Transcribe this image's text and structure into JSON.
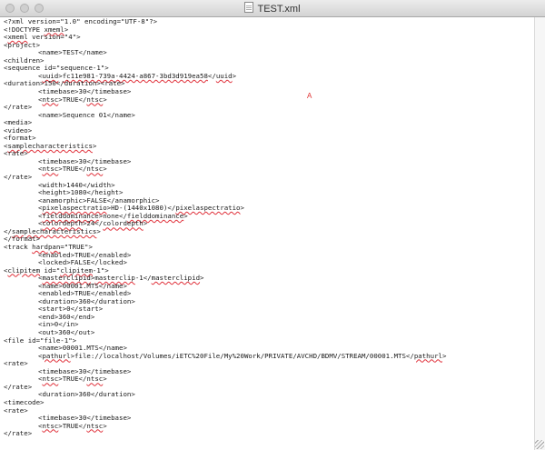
{
  "window": {
    "title": "TEST.xml",
    "cursor_mark": "A"
  },
  "lines": [
    {
      "indent": 0,
      "parts": [
        {
          "t": "<?xml version=\"1.0\" encoding=\"UTF-8\"?>"
        }
      ]
    },
    {
      "indent": 0,
      "parts": [
        {
          "t": "<!DOCTYPE "
        },
        {
          "t": "xmeml",
          "spell": true
        },
        {
          "t": ">"
        }
      ]
    },
    {
      "indent": 0,
      "parts": [
        {
          "t": "<"
        },
        {
          "t": "xmeml",
          "spell": true
        },
        {
          "t": " version=\"4\">"
        }
      ]
    },
    {
      "indent": 0,
      "parts": [
        {
          "t": "<project>"
        }
      ]
    },
    {
      "indent": 1,
      "parts": [
        {
          "t": "<name>TEST</name>"
        }
      ]
    },
    {
      "indent": 0,
      "parts": [
        {
          "t": "<children>"
        }
      ]
    },
    {
      "indent": 0,
      "parts": [
        {
          "t": "<sequence id=\"sequence-1\">"
        }
      ]
    },
    {
      "indent": 1,
      "parts": [
        {
          "t": "<"
        },
        {
          "t": "uuid",
          "spell": true
        },
        {
          "t": ">"
        },
        {
          "t": "fc11e981-739a-4424-a867-3bd3d919ea58",
          "spell": true
        },
        {
          "t": "</"
        },
        {
          "t": "uuid",
          "spell": true
        },
        {
          "t": ">"
        }
      ]
    },
    {
      "indent": 0,
      "parts": [
        {
          "t": "<duration>150</duration><rate>"
        }
      ]
    },
    {
      "indent": 1,
      "parts": [
        {
          "t": "<timebase>30</timebase>"
        }
      ]
    },
    {
      "indent": 1,
      "parts": [
        {
          "t": "<"
        },
        {
          "t": "ntsc",
          "spell": true
        },
        {
          "t": ">TRUE</"
        },
        {
          "t": "ntsc",
          "spell": true
        },
        {
          "t": ">"
        }
      ]
    },
    {
      "indent": 0,
      "parts": [
        {
          "t": "</rate>"
        }
      ]
    },
    {
      "indent": 1,
      "parts": [
        {
          "t": "<name>Sequence 01</name>"
        }
      ]
    },
    {
      "indent": 0,
      "parts": [
        {
          "t": "<media>"
        }
      ]
    },
    {
      "indent": 0,
      "parts": [
        {
          "t": "<video>"
        }
      ]
    },
    {
      "indent": 0,
      "parts": [
        {
          "t": "<format>"
        }
      ]
    },
    {
      "indent": 0,
      "parts": [
        {
          "t": "<"
        },
        {
          "t": "samplecharacteristics",
          "spell": true
        },
        {
          "t": ">"
        }
      ]
    },
    {
      "indent": 0,
      "parts": [
        {
          "t": "<rate>"
        }
      ]
    },
    {
      "indent": 1,
      "parts": [
        {
          "t": "<timebase>30</timebase>"
        }
      ]
    },
    {
      "indent": 1,
      "parts": [
        {
          "t": "<"
        },
        {
          "t": "ntsc",
          "spell": true
        },
        {
          "t": ">TRUE</"
        },
        {
          "t": "ntsc",
          "spell": true
        },
        {
          "t": ">"
        }
      ]
    },
    {
      "indent": 0,
      "parts": [
        {
          "t": "</rate>"
        }
      ]
    },
    {
      "indent": 1,
      "parts": [
        {
          "t": "<width>1440</width>"
        }
      ]
    },
    {
      "indent": 1,
      "parts": [
        {
          "t": "<height>1080</height>"
        }
      ]
    },
    {
      "indent": 1,
      "parts": [
        {
          "t": "<anamorphic>FALSE</anamorphic>"
        }
      ]
    },
    {
      "indent": 1,
      "parts": [
        {
          "t": "<"
        },
        {
          "t": "pixelaspectratio",
          "spell": true
        },
        {
          "t": ">HD-(1440x1080)</"
        },
        {
          "t": "pixelaspectratio",
          "spell": true
        },
        {
          "t": ">"
        }
      ]
    },
    {
      "indent": 1,
      "parts": [
        {
          "t": "<"
        },
        {
          "t": "fielddominance",
          "spell": true
        },
        {
          "t": ">none</"
        },
        {
          "t": "fielddominance",
          "spell": true
        },
        {
          "t": ">"
        }
      ]
    },
    {
      "indent": 1,
      "parts": [
        {
          "t": "<"
        },
        {
          "t": "colordepth",
          "spell": true
        },
        {
          "t": ">24</"
        },
        {
          "t": "colordepth",
          "spell": true
        },
        {
          "t": ">"
        }
      ]
    },
    {
      "indent": 0,
      "parts": [
        {
          "t": "</"
        },
        {
          "t": "samplecharacteristics",
          "spell": true
        },
        {
          "t": ">"
        }
      ]
    },
    {
      "indent": 0,
      "parts": [
        {
          "t": "</format>"
        }
      ]
    },
    {
      "indent": 0,
      "parts": [
        {
          "t": "<track "
        },
        {
          "t": "hardpan",
          "spell": true
        },
        {
          "t": "=\"TRUE\">"
        }
      ]
    },
    {
      "indent": 1,
      "parts": [
        {
          "t": "<enabled>TRUE</enabled>"
        }
      ]
    },
    {
      "indent": 1,
      "parts": [
        {
          "t": "<locked>FALSE</locked>"
        }
      ]
    },
    {
      "indent": 0,
      "parts": [
        {
          "t": "<"
        },
        {
          "t": "clipitem",
          "spell": true
        },
        {
          "t": " id=\""
        },
        {
          "t": "clipitem",
          "spell": true
        },
        {
          "t": "-1\">"
        }
      ]
    },
    {
      "indent": 1,
      "parts": [
        {
          "t": "<"
        },
        {
          "t": "masterclipid",
          "spell": true
        },
        {
          "t": ">"
        },
        {
          "t": "masterclip",
          "spell": true
        },
        {
          "t": "-1</"
        },
        {
          "t": "masterclipid",
          "spell": true
        },
        {
          "t": ">"
        }
      ]
    },
    {
      "indent": 1,
      "parts": [
        {
          "t": "<name>00001.MTS</name>"
        }
      ]
    },
    {
      "indent": 1,
      "parts": [
        {
          "t": "<enabled>TRUE</enabled>"
        }
      ]
    },
    {
      "indent": 1,
      "parts": [
        {
          "t": "<duration>360</duration>"
        }
      ]
    },
    {
      "indent": 1,
      "parts": [
        {
          "t": "<start>0</start>"
        }
      ]
    },
    {
      "indent": 1,
      "parts": [
        {
          "t": "<end>360</end>"
        }
      ]
    },
    {
      "indent": 1,
      "parts": [
        {
          "t": "<in>0</in>"
        }
      ]
    },
    {
      "indent": 1,
      "parts": [
        {
          "t": "<out>360</out>"
        }
      ]
    },
    {
      "indent": 0,
      "parts": [
        {
          "t": "<file id=\"file-1\">"
        }
      ]
    },
    {
      "indent": 1,
      "parts": [
        {
          "t": "<name>00001.MTS</name>"
        }
      ]
    },
    {
      "indent": 1,
      "parts": [
        {
          "t": "<"
        },
        {
          "t": "pathurl",
          "spell": true
        },
        {
          "t": ">file://localhost/Volumes/iETC%20File/My%20Work/PRIVATE/AVCHD/BDMV/STREAM/00001.MTS</"
        },
        {
          "t": "pathurl",
          "spell": true
        },
        {
          "t": ">"
        }
      ]
    },
    {
      "indent": 0,
      "parts": [
        {
          "t": "<rate>"
        }
      ]
    },
    {
      "indent": 1,
      "parts": [
        {
          "t": "<timebase>30</timebase>"
        }
      ]
    },
    {
      "indent": 1,
      "parts": [
        {
          "t": "<"
        },
        {
          "t": "ntsc",
          "spell": true
        },
        {
          "t": ">TRUE</"
        },
        {
          "t": "ntsc",
          "spell": true
        },
        {
          "t": ">"
        }
      ]
    },
    {
      "indent": 0,
      "parts": [
        {
          "t": "</rate>"
        }
      ]
    },
    {
      "indent": 1,
      "parts": [
        {
          "t": "<duration>360</duration>"
        }
      ]
    },
    {
      "indent": 0,
      "parts": [
        {
          "t": "<timecode>"
        }
      ]
    },
    {
      "indent": 0,
      "parts": [
        {
          "t": "<rate>"
        }
      ]
    },
    {
      "indent": 1,
      "parts": [
        {
          "t": "<timebase>30</timebase>"
        }
      ]
    },
    {
      "indent": 1,
      "parts": [
        {
          "t": "<"
        },
        {
          "t": "ntsc",
          "spell": true
        },
        {
          "t": ">TRUE</"
        },
        {
          "t": "ntsc",
          "spell": true
        },
        {
          "t": ">"
        }
      ]
    },
    {
      "indent": 0,
      "parts": [
        {
          "t": "</rate>"
        }
      ]
    }
  ]
}
